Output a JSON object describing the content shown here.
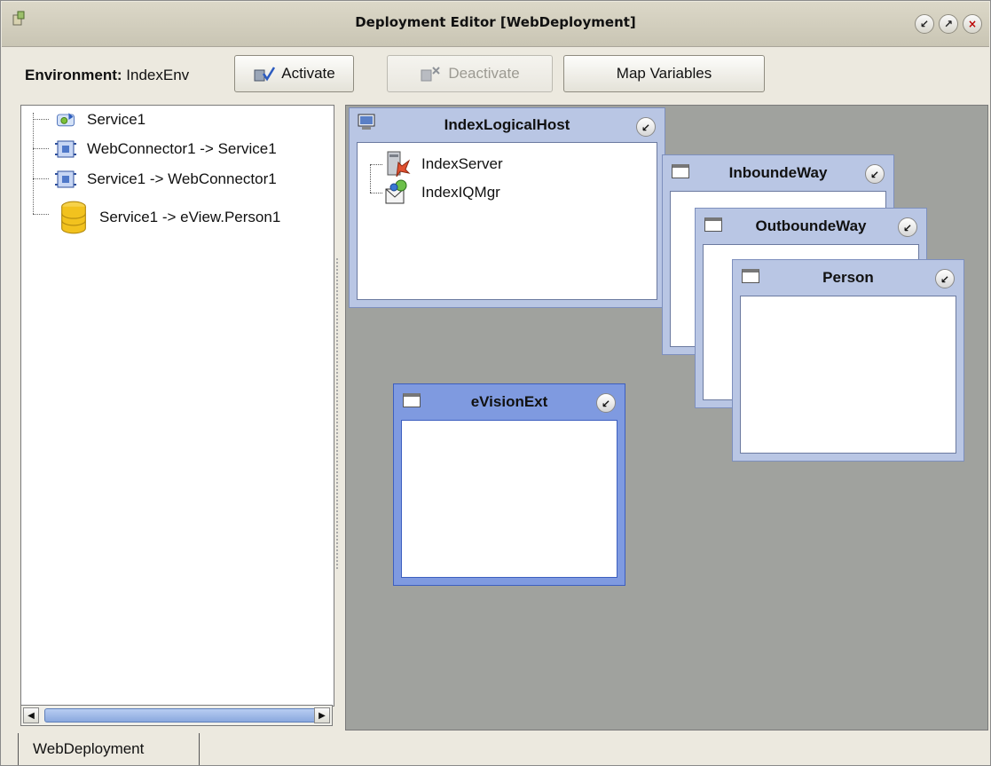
{
  "window": {
    "title": "Deployment Editor [WebDeployment]",
    "buttons": {
      "restore": "↙",
      "maximize": "↗",
      "close": "×"
    }
  },
  "toolbar": {
    "environment_label": "Environment:",
    "environment_value": "IndexEnv",
    "activate_label": "Activate",
    "deactivate_label": "Deactivate",
    "map_variables_label": "Map Variables"
  },
  "tree": {
    "items": [
      {
        "label": "Service1",
        "icon": "service-icon"
      },
      {
        "label": "WebConnector1 -> Service1",
        "icon": "connector-icon"
      },
      {
        "label": "Service1 -> WebConnector1",
        "icon": "connector-icon"
      },
      {
        "label": "Service1 -> eView.Person1",
        "icon": "database-icon"
      }
    ]
  },
  "canvas": {
    "frames": {
      "logical_host": {
        "title": "IndexLogicalHost",
        "children": [
          {
            "label": "IndexServer",
            "icon": "server-icon"
          },
          {
            "label": "IndexIQMgr",
            "icon": "iqmanager-icon"
          }
        ]
      },
      "inbound": {
        "title": "InboundeWay"
      },
      "outbound": {
        "title": "OutboundeWay"
      },
      "person": {
        "title": "Person"
      },
      "evision": {
        "title": "eVisionExt"
      }
    }
  },
  "tabs": [
    {
      "label": "WebDeployment"
    }
  ],
  "colors": {
    "canvas": "#a0a29e",
    "frame_inactive": "#b9c6e4",
    "frame_active": "#7f9ae0"
  }
}
